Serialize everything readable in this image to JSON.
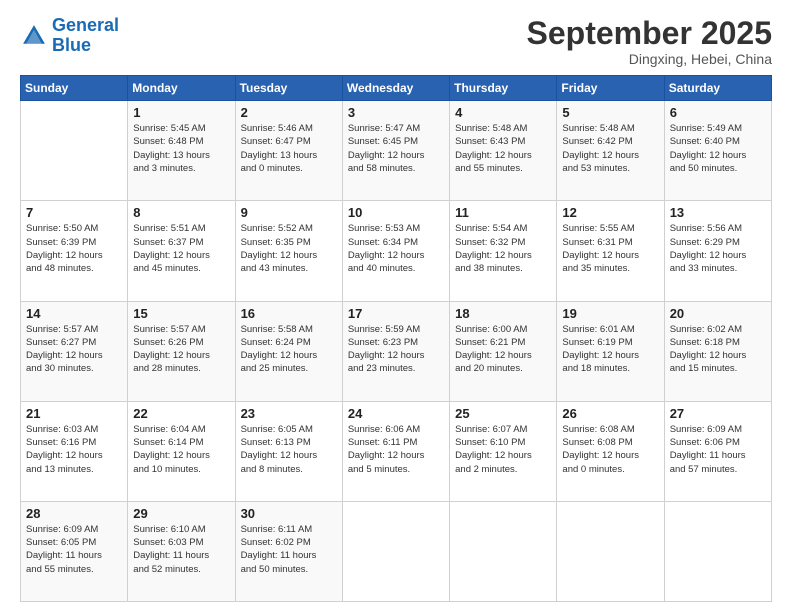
{
  "logo": {
    "line1": "General",
    "line2": "Blue"
  },
  "header": {
    "month": "September 2025",
    "location": "Dingxing, Hebei, China"
  },
  "weekdays": [
    "Sunday",
    "Monday",
    "Tuesday",
    "Wednesday",
    "Thursday",
    "Friday",
    "Saturday"
  ],
  "weeks": [
    [
      {
        "day": "",
        "info": ""
      },
      {
        "day": "1",
        "info": "Sunrise: 5:45 AM\nSunset: 6:48 PM\nDaylight: 13 hours\nand 3 minutes."
      },
      {
        "day": "2",
        "info": "Sunrise: 5:46 AM\nSunset: 6:47 PM\nDaylight: 13 hours\nand 0 minutes."
      },
      {
        "day": "3",
        "info": "Sunrise: 5:47 AM\nSunset: 6:45 PM\nDaylight: 12 hours\nand 58 minutes."
      },
      {
        "day": "4",
        "info": "Sunrise: 5:48 AM\nSunset: 6:43 PM\nDaylight: 12 hours\nand 55 minutes."
      },
      {
        "day": "5",
        "info": "Sunrise: 5:48 AM\nSunset: 6:42 PM\nDaylight: 12 hours\nand 53 minutes."
      },
      {
        "day": "6",
        "info": "Sunrise: 5:49 AM\nSunset: 6:40 PM\nDaylight: 12 hours\nand 50 minutes."
      }
    ],
    [
      {
        "day": "7",
        "info": "Sunrise: 5:50 AM\nSunset: 6:39 PM\nDaylight: 12 hours\nand 48 minutes."
      },
      {
        "day": "8",
        "info": "Sunrise: 5:51 AM\nSunset: 6:37 PM\nDaylight: 12 hours\nand 45 minutes."
      },
      {
        "day": "9",
        "info": "Sunrise: 5:52 AM\nSunset: 6:35 PM\nDaylight: 12 hours\nand 43 minutes."
      },
      {
        "day": "10",
        "info": "Sunrise: 5:53 AM\nSunset: 6:34 PM\nDaylight: 12 hours\nand 40 minutes."
      },
      {
        "day": "11",
        "info": "Sunrise: 5:54 AM\nSunset: 6:32 PM\nDaylight: 12 hours\nand 38 minutes."
      },
      {
        "day": "12",
        "info": "Sunrise: 5:55 AM\nSunset: 6:31 PM\nDaylight: 12 hours\nand 35 minutes."
      },
      {
        "day": "13",
        "info": "Sunrise: 5:56 AM\nSunset: 6:29 PM\nDaylight: 12 hours\nand 33 minutes."
      }
    ],
    [
      {
        "day": "14",
        "info": "Sunrise: 5:57 AM\nSunset: 6:27 PM\nDaylight: 12 hours\nand 30 minutes."
      },
      {
        "day": "15",
        "info": "Sunrise: 5:57 AM\nSunset: 6:26 PM\nDaylight: 12 hours\nand 28 minutes."
      },
      {
        "day": "16",
        "info": "Sunrise: 5:58 AM\nSunset: 6:24 PM\nDaylight: 12 hours\nand 25 minutes."
      },
      {
        "day": "17",
        "info": "Sunrise: 5:59 AM\nSunset: 6:23 PM\nDaylight: 12 hours\nand 23 minutes."
      },
      {
        "day": "18",
        "info": "Sunrise: 6:00 AM\nSunset: 6:21 PM\nDaylight: 12 hours\nand 20 minutes."
      },
      {
        "day": "19",
        "info": "Sunrise: 6:01 AM\nSunset: 6:19 PM\nDaylight: 12 hours\nand 18 minutes."
      },
      {
        "day": "20",
        "info": "Sunrise: 6:02 AM\nSunset: 6:18 PM\nDaylight: 12 hours\nand 15 minutes."
      }
    ],
    [
      {
        "day": "21",
        "info": "Sunrise: 6:03 AM\nSunset: 6:16 PM\nDaylight: 12 hours\nand 13 minutes."
      },
      {
        "day": "22",
        "info": "Sunrise: 6:04 AM\nSunset: 6:14 PM\nDaylight: 12 hours\nand 10 minutes."
      },
      {
        "day": "23",
        "info": "Sunrise: 6:05 AM\nSunset: 6:13 PM\nDaylight: 12 hours\nand 8 minutes."
      },
      {
        "day": "24",
        "info": "Sunrise: 6:06 AM\nSunset: 6:11 PM\nDaylight: 12 hours\nand 5 minutes."
      },
      {
        "day": "25",
        "info": "Sunrise: 6:07 AM\nSunset: 6:10 PM\nDaylight: 12 hours\nand 2 minutes."
      },
      {
        "day": "26",
        "info": "Sunrise: 6:08 AM\nSunset: 6:08 PM\nDaylight: 12 hours\nand 0 minutes."
      },
      {
        "day": "27",
        "info": "Sunrise: 6:09 AM\nSunset: 6:06 PM\nDaylight: 11 hours\nand 57 minutes."
      }
    ],
    [
      {
        "day": "28",
        "info": "Sunrise: 6:09 AM\nSunset: 6:05 PM\nDaylight: 11 hours\nand 55 minutes."
      },
      {
        "day": "29",
        "info": "Sunrise: 6:10 AM\nSunset: 6:03 PM\nDaylight: 11 hours\nand 52 minutes."
      },
      {
        "day": "30",
        "info": "Sunrise: 6:11 AM\nSunset: 6:02 PM\nDaylight: 11 hours\nand 50 minutes."
      },
      {
        "day": "",
        "info": ""
      },
      {
        "day": "",
        "info": ""
      },
      {
        "day": "",
        "info": ""
      },
      {
        "day": "",
        "info": ""
      }
    ]
  ]
}
